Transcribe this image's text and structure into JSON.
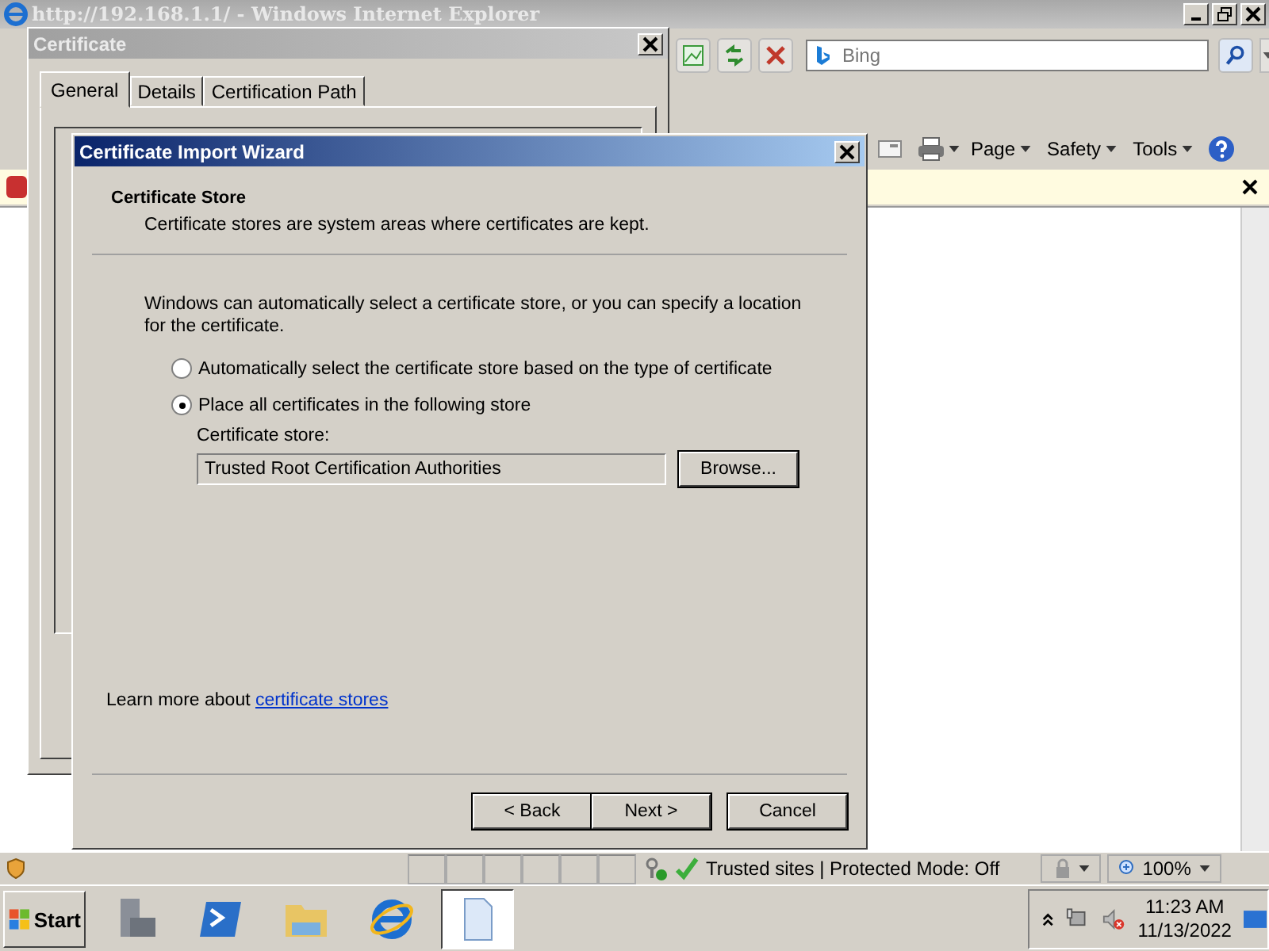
{
  "browser": {
    "title": "http://192.168.1.1/ - Windows Internet Explorer",
    "search": {
      "placeholder": "Bing"
    },
    "command_bar": [
      {
        "label": "Page",
        "kind": "menu"
      },
      {
        "label": "Safety",
        "kind": "menu"
      },
      {
        "label": "Tools",
        "kind": "menu"
      }
    ],
    "status_bar": {
      "zone": "Trusted sites | Protected Mode: Off",
      "zoom": "100%"
    }
  },
  "certificate_dialog": {
    "title": "Certificate",
    "tabs": [
      {
        "label": "General",
        "selected": true
      },
      {
        "label": "Details",
        "selected": false
      },
      {
        "label": "Certification Path",
        "selected": false
      }
    ]
  },
  "wizard": {
    "title": "Certificate Import Wizard",
    "heading": "Certificate Store",
    "subheading": "Certificate stores are system areas where certificates are kept.",
    "intro": "Windows can automatically select a certificate store, or you can specify a location for the certificate.",
    "options": [
      {
        "label": "Automatically select the certificate store based on the type of certificate",
        "selected": false
      },
      {
        "label": "Place all certificates in the following store",
        "selected": true
      }
    ],
    "store_label": "Certificate store:",
    "store_value": "Trusted Root Certification Authorities",
    "browse": "Browse...",
    "learn_more": "Learn more about ",
    "learn_link": "certificate stores",
    "buttons": [
      {
        "label": "< Back",
        "kind": "nav"
      },
      {
        "label": "Next >",
        "kind": "nav"
      },
      {
        "label": "Cancel",
        "kind": "cancel"
      }
    ]
  },
  "taskbar": {
    "start": "Start",
    "time": "11:23 AM",
    "date": "11/13/2022"
  }
}
